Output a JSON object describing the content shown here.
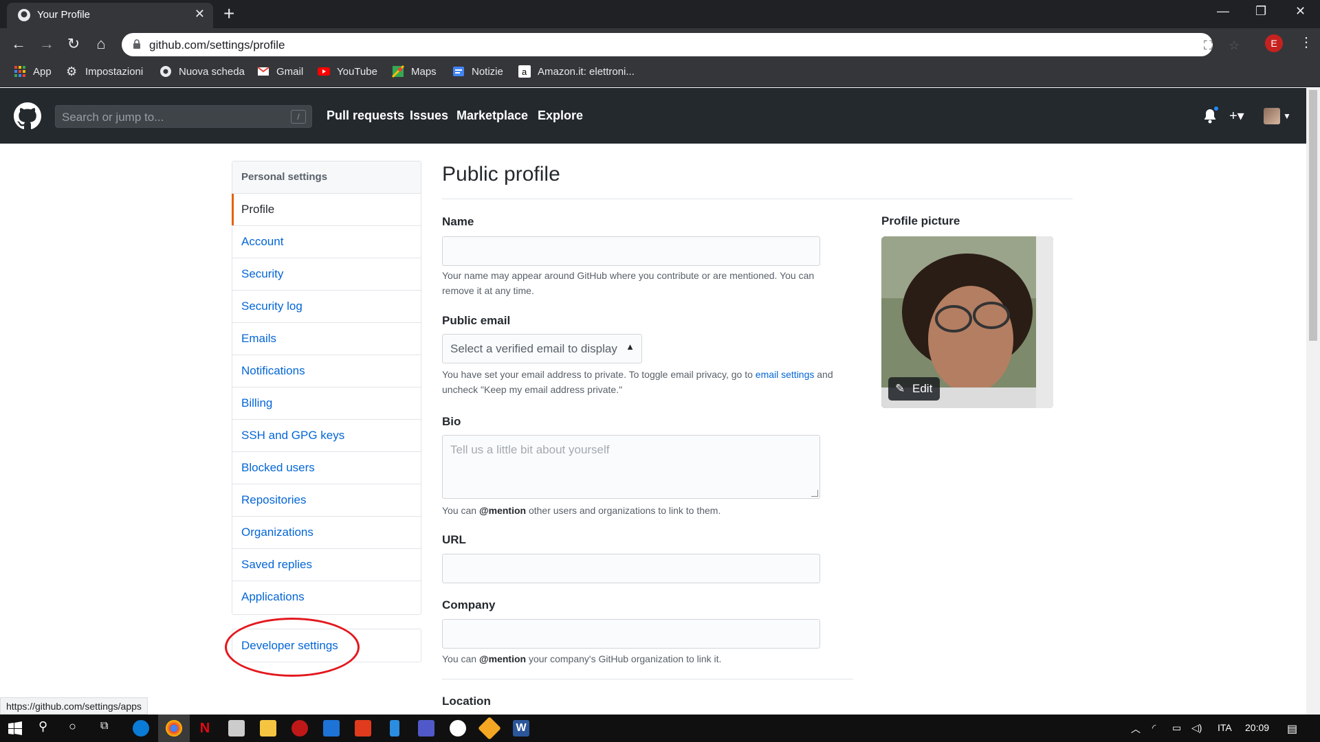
{
  "browser": {
    "tab_title": "Your Profile",
    "tab_close": "✕",
    "new_tab": "+",
    "url": "github.com/settings/profile",
    "profile_initial": "E",
    "bookmarks": [
      {
        "label": "App",
        "icon": "apps-grid-icon"
      },
      {
        "label": "Impostazioni",
        "icon": "gear-icon"
      },
      {
        "label": "Nuova scheda",
        "icon": "chrome-icon"
      },
      {
        "label": "Gmail",
        "icon": "gmail-icon"
      },
      {
        "label": "YouTube",
        "icon": "youtube-icon"
      },
      {
        "label": "Maps",
        "icon": "maps-icon"
      },
      {
        "label": "Notizie",
        "icon": "news-icon"
      },
      {
        "label": "Amazon.it: elettroni...",
        "icon": "amazon-icon"
      }
    ],
    "status_url": "https://github.com/settings/apps"
  },
  "github_header": {
    "search_placeholder": "Search or jump to...",
    "search_shortcut": "/",
    "nav": [
      "Pull requests",
      "Issues",
      "Marketplace",
      "Explore"
    ]
  },
  "sidebar": {
    "heading": "Personal settings",
    "items": [
      {
        "label": "Profile",
        "active": true
      },
      {
        "label": "Account"
      },
      {
        "label": "Security"
      },
      {
        "label": "Security log"
      },
      {
        "label": "Emails"
      },
      {
        "label": "Notifications"
      },
      {
        "label": "Billing"
      },
      {
        "label": "SSH and GPG keys"
      },
      {
        "label": "Blocked users"
      },
      {
        "label": "Repositories"
      },
      {
        "label": "Organizations"
      },
      {
        "label": "Saved replies"
      },
      {
        "label": "Applications"
      }
    ],
    "developer_settings": "Developer settings"
  },
  "main": {
    "title": "Public profile",
    "name_label": "Name",
    "name_value": "",
    "name_note": "Your name may appear around GitHub where you contribute or are mentioned. You can remove it at any time.",
    "email_label": "Public email",
    "email_select": "Select a verified email to display",
    "email_note_pre": "You have set your email address to private. To toggle email privacy, go to ",
    "email_note_link": "email settings",
    "email_note_post": " and uncheck \"Keep my email address private.\"",
    "bio_label": "Bio",
    "bio_placeholder": "Tell us a little bit about yourself",
    "bio_note_pre": "You can ",
    "bio_note_mention": "@mention",
    "bio_note_post": " other users and organizations to link to them.",
    "url_label": "URL",
    "url_value": "",
    "company_label": "Company",
    "company_value": "",
    "company_note_pre": "You can ",
    "company_note_mention": "@mention",
    "company_note_post": " your company's GitHub organization to link it.",
    "location_label": "Location",
    "picture_label": "Profile picture",
    "edit_label": "Edit"
  },
  "taskbar": {
    "language": "ITA",
    "time": "20:09"
  },
  "colors": {
    "gh_header": "#24292e",
    "link": "#0366d6",
    "active_marker": "#e36209",
    "annotation_circle": "#e3181e"
  }
}
